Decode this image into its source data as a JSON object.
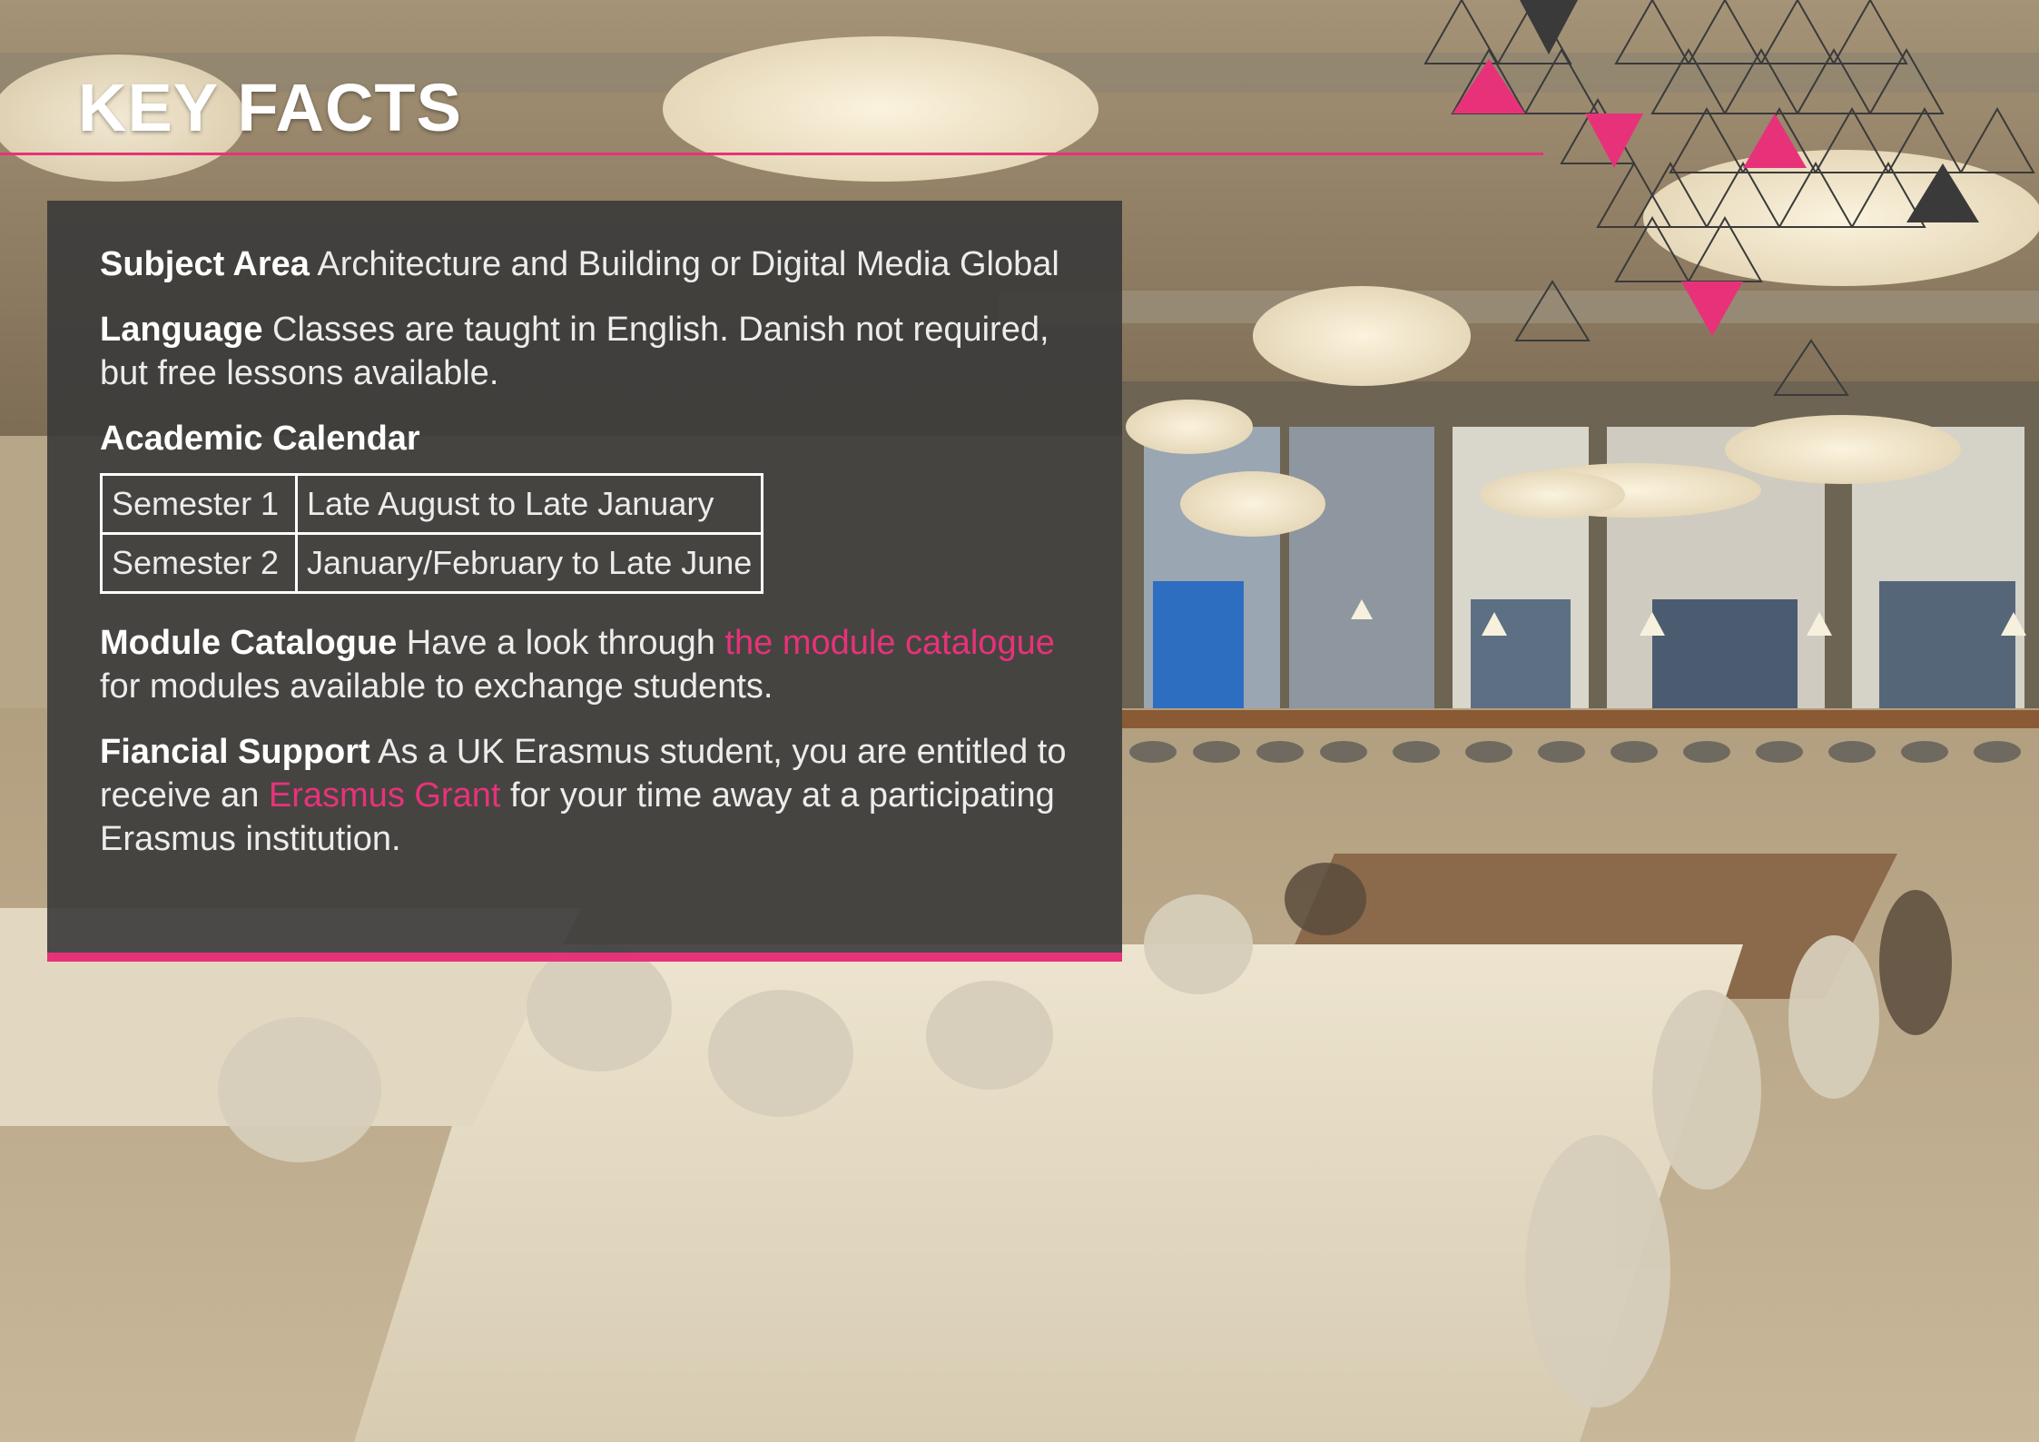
{
  "page": {
    "title": "KEY FACTS",
    "accent_color": "#e7327a"
  },
  "facts": {
    "subject": {
      "label": "Subject Area",
      "text": "Architecture and Building or Digital Media Global"
    },
    "language": {
      "label": "Language",
      "text": "Classes are taught in English. Danish not required, but free lessons available."
    },
    "calendar": {
      "heading": "Academic Calendar",
      "rows": [
        {
          "semester": "Semester 1",
          "dates": "Late August to Late January"
        },
        {
          "semester": "Semester 2",
          "dates": "January/February to Late June"
        }
      ]
    },
    "module": {
      "label": "Module Catalogue",
      "text_before": "Have a look through",
      "link": "the module catalogue",
      "text_after": "for modules available to exchange students."
    },
    "financial": {
      "label": "Fiancial Support",
      "text_before": "As a UK Erasmus student, you are entitled to receive an",
      "link": "Erasmus Grant",
      "text_after": "for your time away at a participating Erasmus institution."
    }
  }
}
